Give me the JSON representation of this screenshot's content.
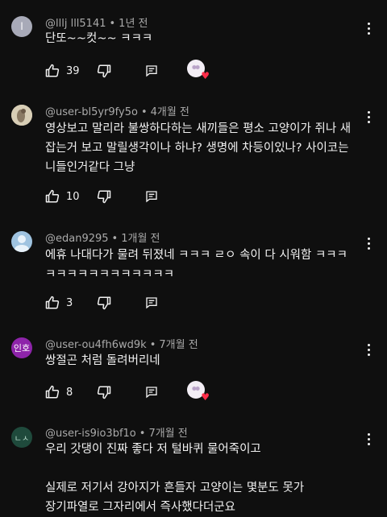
{
  "comments": [
    {
      "username": "@lllj lll5141",
      "time": "1년 전",
      "avatar_letter": "l",
      "avatar_color": "#a8aab8",
      "text": "단또~~컷~~ ㅋㅋㅋ",
      "likes": "39",
      "creator_heart": true
    },
    {
      "username": "@user-bl5yr9fy5o",
      "time": "4개월 전",
      "avatar_letter": "",
      "avatar_color": "#c9bfa7",
      "text": "영상보고 말리라 불쌍하다하는 새끼들은 평소 고양이가 쥐나 새 잡는거 보고 말릴생각이나 하냐? 생명에 차등이있나? 사이코는 니들인거같다 그냥",
      "likes": "10",
      "creator_heart": false
    },
    {
      "username": "@edan9295",
      "time": "1개월 전",
      "avatar_letter": "",
      "avatar_color": "#9fc3e0",
      "text": "에휴 나대다가 물려 뒤졌네 ㅋㅋㅋ ㄹㅇ 속이 다 시워함 ㅋㅋㅋ ㅋㅋㅋㅋㅋㅋㅋㅋㅋㅋㅋㅋ",
      "likes": "3",
      "creator_heart": false
    },
    {
      "username": "@user-ou4fh6wd9k",
      "time": "7개월 전",
      "avatar_letter": "인호",
      "avatar_color": "#8e24aa",
      "text": "쌍절곤 처럼 돌려버리네",
      "likes": "8",
      "creator_heart": true
    },
    {
      "username": "@user-is9io3bf1o",
      "time": "7개월 전",
      "avatar_letter": "ㄴㅅ",
      "avatar_color": "#1f4a3c",
      "text": "우리 갓댕이 진짜 좋다 저 털바퀴 물어죽이고\n\n실제로 저기서 강아지가 흔들자 고양이는 몇분도 못가 장기파열로 그자리에서 즉사했다더군요",
      "likes": "",
      "creator_heart": false
    }
  ],
  "icons": {
    "like": "thumbs-up-icon",
    "dislike": "thumbs-down-icon",
    "reply": "reply-icon",
    "more": "more-vert-icon"
  }
}
